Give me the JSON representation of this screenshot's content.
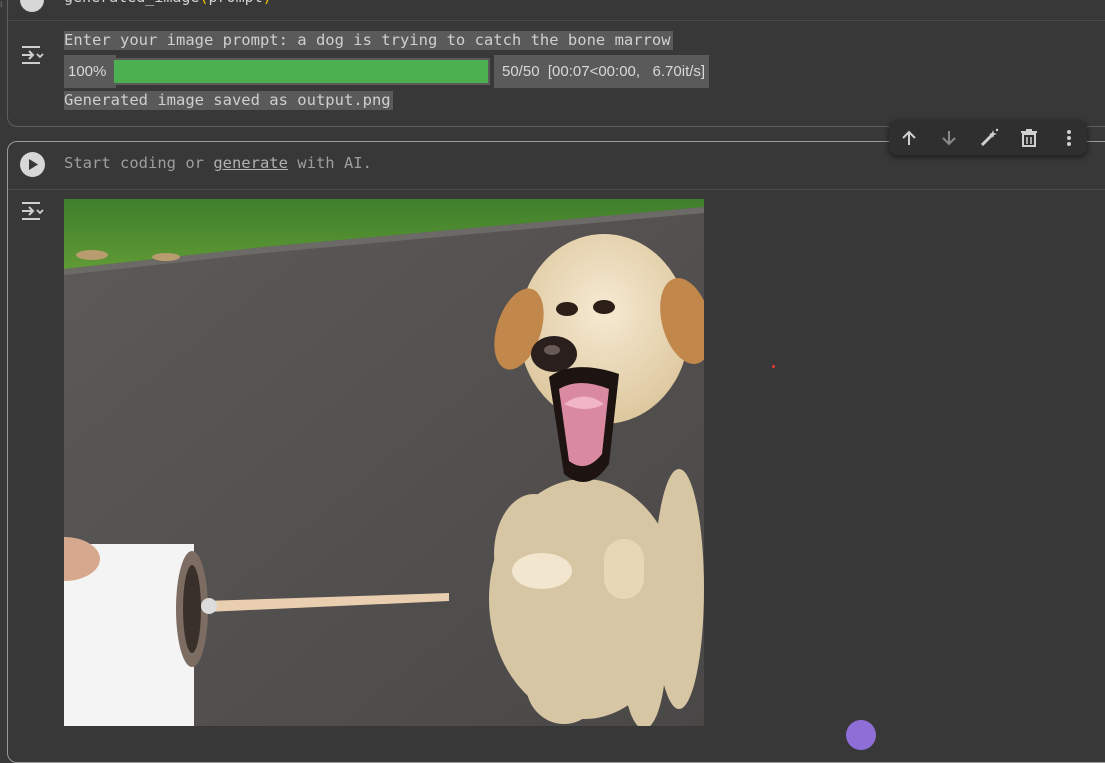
{
  "code_cell": {
    "code_fn": "generated_image",
    "code_paren_open": "(",
    "code_arg": "prompt",
    "code_paren_close": ")"
  },
  "output": {
    "prompt_line": "Enter your image prompt: a dog is trying to catch the bone marrow",
    "progress": {
      "percent_label": "100%",
      "fraction": 1.0,
      "stats": "50/50  [00:07<00:00,   6.70it/s]",
      "bar_color": "#4caf50"
    },
    "saved_line": "Generated image saved as output.png"
  },
  "new_cell": {
    "placeholder_start": "Start coding or ",
    "placeholder_link": "generate",
    "placeholder_end": " with AI."
  },
  "toolbar": {
    "icons": [
      "arrow-up-icon",
      "arrow-down-icon",
      "magic-edit-icon",
      "trash-icon",
      "more-vert-icon"
    ]
  },
  "image": {
    "subject": "dog-catching-bone-illustration"
  }
}
